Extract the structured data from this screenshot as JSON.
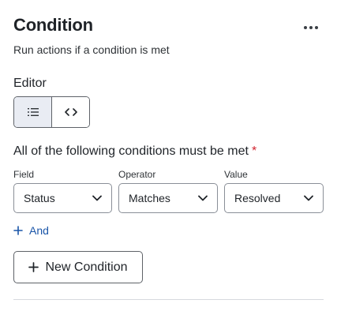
{
  "header": {
    "title": "Condition",
    "subtitle": "Run actions if a condition is met"
  },
  "editor": {
    "label": "Editor",
    "modes": [
      {
        "icon": "list-icon",
        "active": true
      },
      {
        "icon": "code-icon",
        "active": false
      }
    ]
  },
  "conditions": {
    "heading": "All of the following conditions must be met",
    "required_mark": "*",
    "columns": {
      "field": "Field",
      "operator": "Operator",
      "value": "Value"
    },
    "rows": [
      {
        "field": "Status",
        "operator": "Matches",
        "value": "Resolved"
      }
    ],
    "and_label": "And",
    "new_condition_label": "New Condition"
  },
  "colors": {
    "link": "#1a55a8",
    "required": "#d1242f",
    "active_segment": "#e9ecf3"
  }
}
